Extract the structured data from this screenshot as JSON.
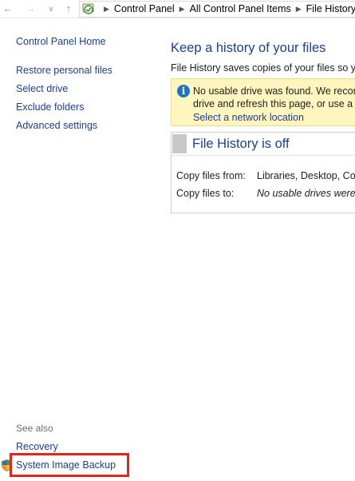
{
  "address_bar": {
    "breadcrumbs": [
      "Control Panel",
      "All Control Panel Items",
      "File History"
    ]
  },
  "left_pane": {
    "home": "Control Panel Home",
    "links": [
      "Restore personal files",
      "Select drive",
      "Exclude folders",
      "Advanced settings"
    ],
    "see_also_heading": "See also",
    "see_also": [
      "Recovery",
      "System Image Backup"
    ]
  },
  "main": {
    "title": "Keep a history of your files",
    "description": "File History saves copies of your files so you",
    "warning": {
      "line1": "No usable drive was found. We recomm",
      "line2": "drive and refresh this page, or use a ne",
      "link": "Select a network location"
    },
    "status": {
      "title": "File History is off",
      "rows": [
        {
          "label": "Copy files from:",
          "value": "Libraries, Desktop, Cont"
        },
        {
          "label": "Copy files to:",
          "value": "No usable drives were fo"
        }
      ]
    }
  },
  "colors": {
    "link": "#1a3e9e",
    "highlight": "#e4251b",
    "warning_bg": "#fff6bf"
  }
}
